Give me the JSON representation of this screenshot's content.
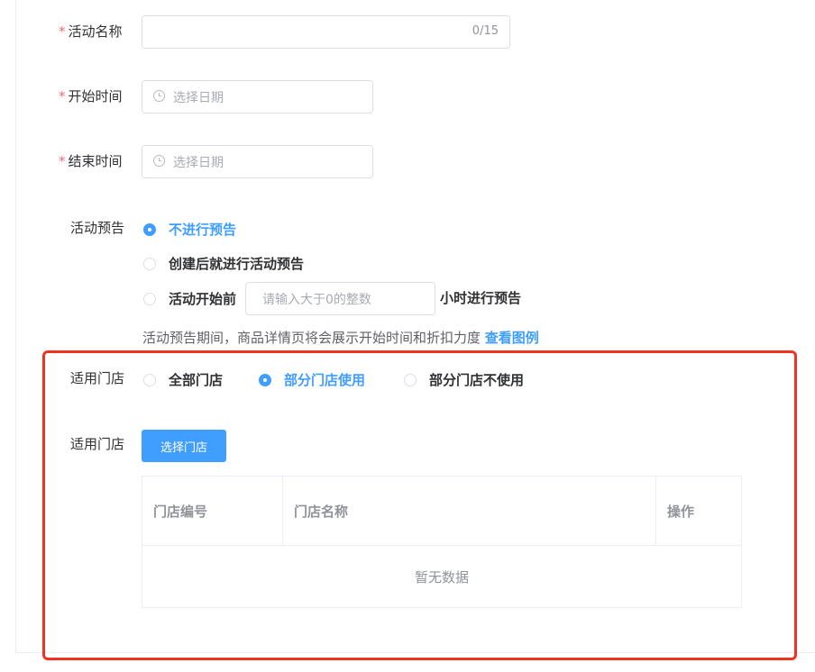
{
  "form": {
    "activity_name": {
      "required_mark": "*",
      "label": "活动名称",
      "value": "",
      "counter": "0/15"
    },
    "start_time": {
      "required_mark": "*",
      "label": "开始时间",
      "placeholder": "选择日期",
      "icon": "clock-icon"
    },
    "end_time": {
      "required_mark": "*",
      "label": "结束时间",
      "placeholder": "选择日期",
      "icon": "clock-icon"
    },
    "preview": {
      "label": "活动预告",
      "options": [
        {
          "label": "不进行预告",
          "checked": true
        },
        {
          "label": "创建后就进行活动预告",
          "checked": false
        },
        {
          "label": "活动开始前",
          "checked": false
        }
      ],
      "hours_placeholder": "请输入大于0的整数",
      "hours_suffix": "小时进行预告",
      "hint": "活动预告期间，商品详情页将会展示开始时间和折扣力度",
      "hint_link": "查看图例"
    },
    "store_scope": {
      "label": "适用门店",
      "options": [
        {
          "label": "全部门店",
          "checked": false
        },
        {
          "label": "部分门店使用",
          "checked": true
        },
        {
          "label": "部分门店不使用",
          "checked": false
        }
      ]
    },
    "store_select": {
      "label": "适用门店",
      "button": "选择门店",
      "table": {
        "columns": [
          "门店编号",
          "门店名称",
          "操作"
        ],
        "rows": [],
        "empty_text": "暂无数据"
      }
    }
  },
  "colors": {
    "primary": "#409eff",
    "required": "#f56c6c",
    "highlight_border": "#f0331f"
  }
}
